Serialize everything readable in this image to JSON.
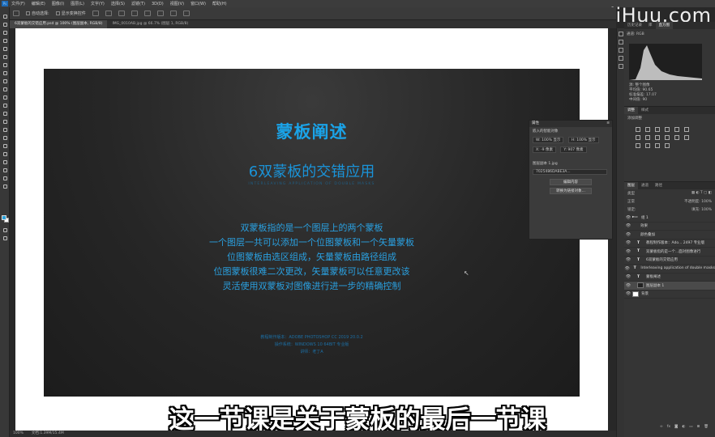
{
  "watermark": "YiiHuu.com",
  "menu": [
    "文件(F)",
    "编辑(E)",
    "图像(I)",
    "图层(L)",
    "文字(Y)",
    "选择(S)",
    "滤镜(T)",
    "3D(D)",
    "视图(V)",
    "窗口(W)",
    "帮助(H)"
  ],
  "options": {
    "auto_select": "自动选择:",
    "transform": "显示变换控件"
  },
  "tabs": [
    {
      "label": "6双蒙板的交错应用.psd @ 100% (图层副本, RGB/8)"
    },
    {
      "label": "IMG_0010AB.jpg @ 66.7% (图层 1, RGB/8)"
    }
  ],
  "slide": {
    "title": "蒙板阐述",
    "subtitle": "6双蒙板的交错应用",
    "english": "INTERLEAVING APPLICATION OF DOUBLE MASKS",
    "body": [
      "双蒙板指的是一个图层上的两个蒙板",
      "一个图层一共可以添加一个位图蒙板和一个矢量蒙板",
      "位图蒙板由选区组成，矢量蒙板由路径组成",
      "位图蒙板很难二次更改，矢量蒙板可以任意更改该",
      "灵活使用双蒙板对图像进行进一步的精确控制"
    ],
    "footer": [
      "教程制作版本：ADOBE PHOTOSHOP CC 2019 20.0.2",
      "操作系统：WINDOWS 10 64BIT 专业版",
      "讲师：老丁A"
    ]
  },
  "subtitle_caption": "这一节课是关于蒙板的最后一节课",
  "status": {
    "zoom": "100%",
    "doc": "文档:1.39M/15.4M"
  },
  "properties": {
    "title": "属性",
    "header": "嵌入的智能对象",
    "w": "W: 100% 显示",
    "h": "H: 100% 显示",
    "x": "X: -9 像素",
    "y": "Y: 907 像素",
    "file_label": "图层副本 1.jpg",
    "file_value": "7025486DABE3A...",
    "btn_edit": "编辑内容",
    "btn_convert": "转换为链接对象..."
  },
  "right_tabs": {
    "top": [
      "历史记录",
      "库",
      "直方图"
    ],
    "mid": [
      "调整",
      "样式"
    ],
    "layers_tabs": [
      "图层",
      "通道",
      "路径"
    ]
  },
  "histogram": {
    "channel_label": "通道:",
    "channel": "RGB",
    "source_label": "源:",
    "source": "整个图像",
    "stats": [
      "平均值: 90.65",
      "标准偏差: 17.07",
      "中间值: 90",
      "像素: 1036800"
    ]
  },
  "adjust_title": "添加调整",
  "layers": {
    "kind": "类型",
    "blend": "正常",
    "opacity_label": "不透明度:",
    "opacity": "100%",
    "lock_label": "锁定:",
    "fill_label": "填充:",
    "fill": "100%",
    "rows": [
      {
        "name": "组 1",
        "type": "group",
        "selected": false
      },
      {
        "name": "效果",
        "type": "fx",
        "selected": false
      },
      {
        "name": "颜色叠加",
        "type": "fx",
        "selected": false
      },
      {
        "name": "教程制作版本：Ado... 2497 专业版",
        "type": "T",
        "selected": false
      },
      {
        "name": "双蒙板指的是一个...面对图像进行",
        "type": "T",
        "selected": false
      },
      {
        "name": "6双蒙板的交错应用",
        "type": "T",
        "selected": false
      },
      {
        "name": "Interleaving application of double masks",
        "type": "T",
        "selected": false
      },
      {
        "name": "蒙板阐述",
        "type": "T",
        "selected": false
      },
      {
        "name": "图层副本 1",
        "type": "img",
        "selected": true
      },
      {
        "name": "背景",
        "type": "bg",
        "selected": false
      }
    ]
  },
  "colors": {
    "accent": "#1aa3e8",
    "fg_swatch": "#2aa0d8"
  }
}
